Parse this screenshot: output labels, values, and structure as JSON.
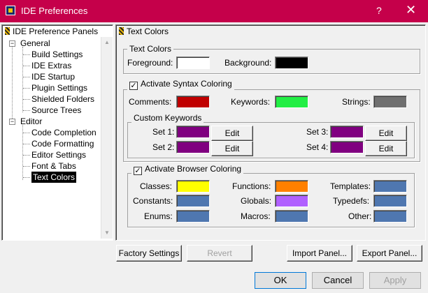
{
  "window": {
    "title": "IDE Preferences",
    "help": "?",
    "close": "✕"
  },
  "left_panel": {
    "header": "IDE Preference Panels",
    "groups": [
      {
        "label": "General",
        "expander": "−",
        "items": [
          "Build Settings",
          "IDE Extras",
          "IDE Startup",
          "Plugin Settings",
          "Shielded Folders",
          "Source Trees"
        ]
      },
      {
        "label": "Editor",
        "expander": "−",
        "items": [
          "Code Completion",
          "Code Formatting",
          "Editor Settings",
          "Font & Tabs",
          "Text Colors"
        ]
      }
    ],
    "selected_item": "Text Colors"
  },
  "right_panel": {
    "header": "Text Colors",
    "text_colors": {
      "title": "Text Colors",
      "foreground_label": "Foreground:",
      "foreground_color": "#ffffff",
      "background_label": "Background:",
      "background_color": "#000000"
    },
    "syntax": {
      "checkbox_label": "Activate Syntax Coloring",
      "checked": true,
      "comments_label": "Comments:",
      "comments_color": "#c00000",
      "keywords_label": "Keywords:",
      "keywords_color": "#22ee44",
      "strings_label": "Strings:",
      "strings_color": "#707070",
      "custom": {
        "title": "Custom Keywords",
        "edit_label": "Edit",
        "sets": [
          {
            "label": "Set 1:",
            "color": "#800080"
          },
          {
            "label": "Set 2:",
            "color": "#800080"
          },
          {
            "label": "Set 3:",
            "color": "#800080"
          },
          {
            "label": "Set 4:",
            "color": "#800080"
          }
        ]
      }
    },
    "browser": {
      "checkbox_label": "Activate Browser Coloring",
      "checked": true,
      "items": [
        {
          "label": "Classes:",
          "color": "#ffff00"
        },
        {
          "label": "Functions:",
          "color": "#ff8000"
        },
        {
          "label": "Templates:",
          "color": "#4f77b0"
        },
        {
          "label": "Constants:",
          "color": "#4f77b0"
        },
        {
          "label": "Globals:",
          "color": "#b060ff"
        },
        {
          "label": "Typedefs:",
          "color": "#4f77b0"
        },
        {
          "label": "Enums:",
          "color": "#4f77b0"
        },
        {
          "label": "Macros:",
          "color": "#4f77b0"
        },
        {
          "label": "Other:",
          "color": "#4f77b0"
        }
      ]
    }
  },
  "panel_buttons": {
    "factory": "Factory Settings",
    "revert": "Revert",
    "import": "Import Panel...",
    "export": "Export Panel..."
  },
  "footer_buttons": {
    "ok": "OK",
    "cancel": "Cancel",
    "apply": "Apply"
  }
}
